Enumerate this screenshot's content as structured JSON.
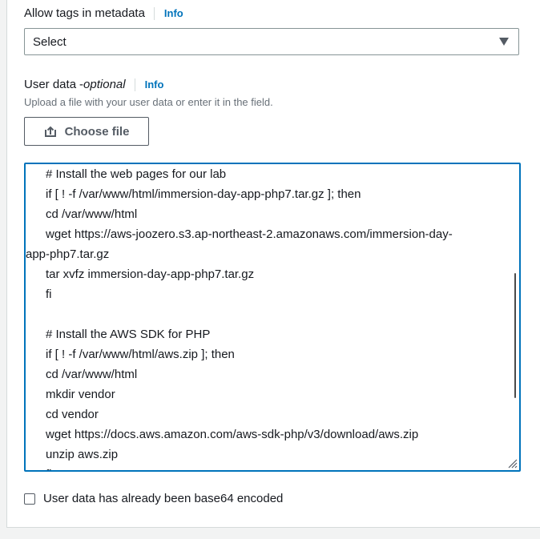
{
  "tags_metadata": {
    "label": "Allow tags in metadata",
    "info": "Info",
    "select_value": "Select"
  },
  "user_data": {
    "label": "User data",
    "label_suffix": "- ",
    "optional": "optional",
    "info": "Info",
    "description": "Upload a file with your user data or enter it in the field.",
    "choose_file": "Choose file",
    "lines": [
      "# Install the web pages for our lab",
      "if [ ! -f /var/www/html/immersion-day-app-php7.tar.gz ]; then",
      "cd /var/www/html",
      "wget https://aws-joozero.s3.ap-northeast-2.amazonaws.com/immersion-day-",
      "app-php7.tar.gz",
      "tar xvfz immersion-day-app-php7.tar.gz",
      "fi",
      "",
      "# Install the AWS SDK for PHP",
      "if [ ! -f /var/www/html/aws.zip ]; then",
      "cd /var/www/html",
      "mkdir vendor",
      "cd vendor",
      "wget https://docs.aws.amazon.com/aws-sdk-php/v3/download/aws.zip",
      "unzip aws.zip",
      "fi"
    ],
    "base64_label": "User data has already been base64 encoded"
  },
  "colors": {
    "link": "#0073bb",
    "focus_border": "#0073bb",
    "text": "#16191f",
    "muted": "#687078"
  },
  "icons": {
    "dropdown": "caret-down-icon",
    "upload": "upload-icon",
    "resize": "resize-handle-icon"
  }
}
